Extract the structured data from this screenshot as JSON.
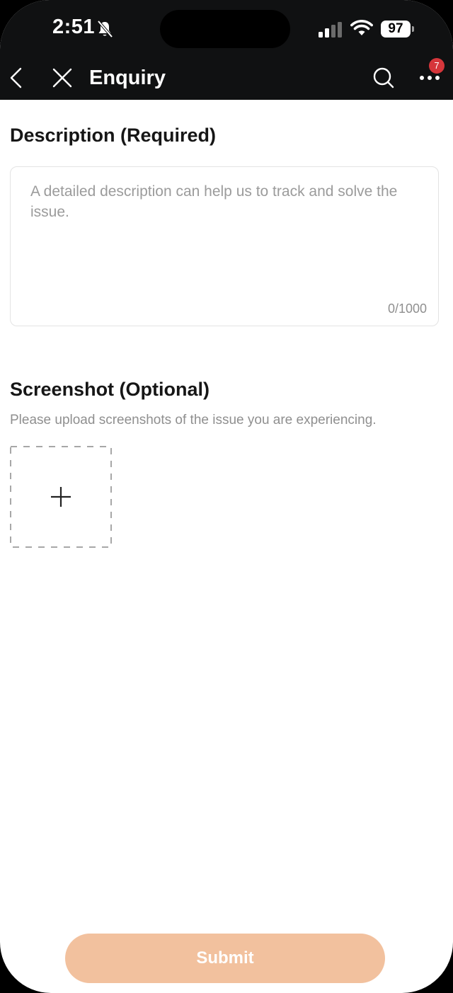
{
  "status_bar": {
    "time": "2:51",
    "battery": "97",
    "icons": [
      "bell-off-icon",
      "signal-icon",
      "wifi-icon",
      "battery-icon"
    ]
  },
  "nav": {
    "title": "Enquiry",
    "badge_count": "7",
    "icons": [
      "back-chevron-icon",
      "close-icon",
      "search-icon",
      "more-icon"
    ]
  },
  "description": {
    "title": "Description (Required)",
    "placeholder": "A detailed description can help us to track and solve the issue.",
    "value": "",
    "counter": "0/1000"
  },
  "screenshot": {
    "title": "Screenshot (Optional)",
    "hint": "Please upload screenshots of the issue you are experiencing.",
    "upload_icon": "plus-icon"
  },
  "footer": {
    "submit_label": "Submit"
  },
  "colors": {
    "header_bg": "#101112",
    "submit_bg": "#f2c19e",
    "badge_bg": "#d6363b",
    "title_text": "#161616",
    "hint_text": "#8f8f8f"
  }
}
